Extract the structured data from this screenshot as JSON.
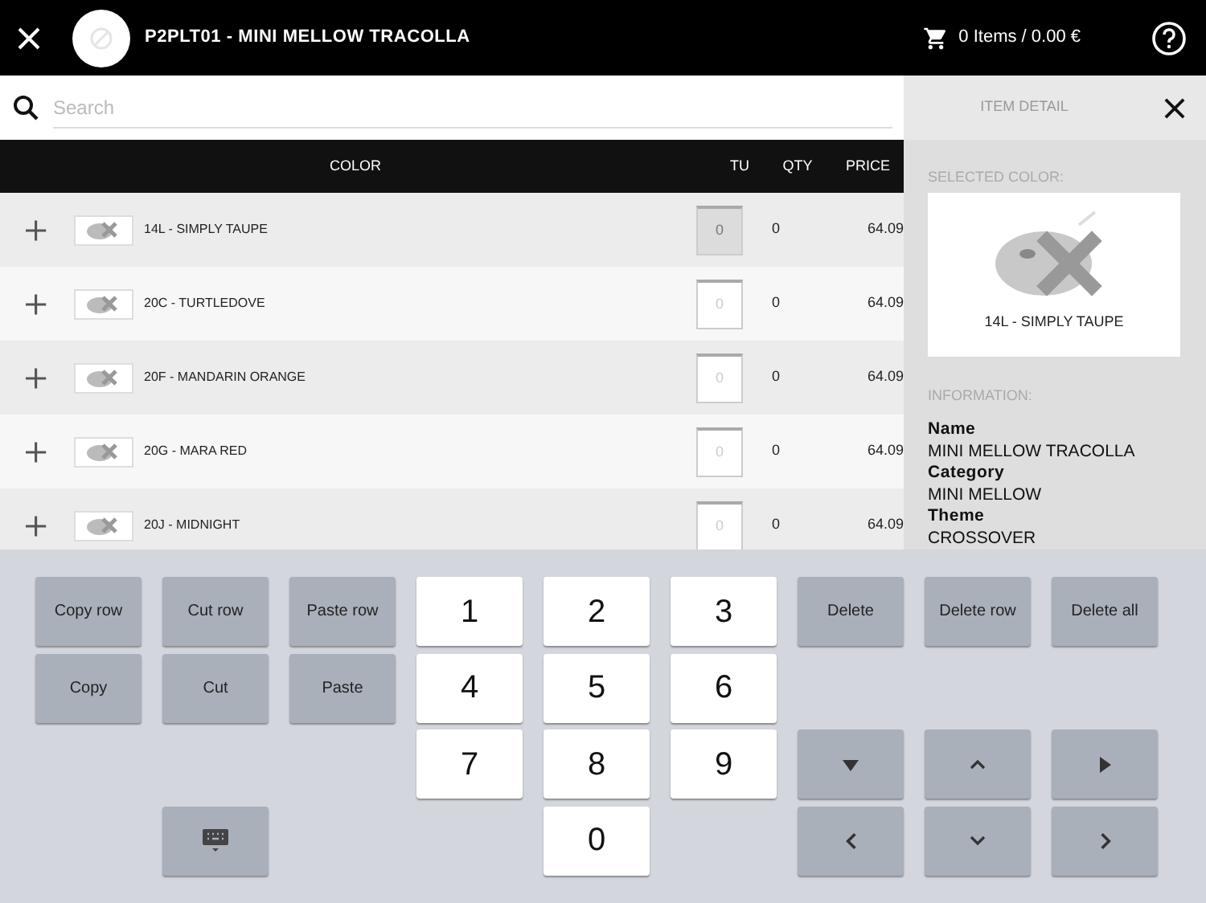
{
  "header": {
    "title": "P2PLT01 - MINI MELLOW TRACOLLA",
    "cart": "0 Items / 0.00 €"
  },
  "search": {
    "placeholder": "Search"
  },
  "table": {
    "columns": [
      "COLOR",
      "TU",
      "QTY",
      "PRICE"
    ],
    "rows": [
      {
        "name": "14L - SIMPLY TAUPE",
        "tu": "0",
        "qty": "0",
        "price": "64.09",
        "selected": true
      },
      {
        "name": "20C - TURTLEDOVE",
        "tu": "0",
        "qty": "0",
        "price": "64.09",
        "selected": false
      },
      {
        "name": "20F - MANDARIN ORANGE",
        "tu": "0",
        "qty": "0",
        "price": "64.09",
        "selected": false
      },
      {
        "name": "20G - MARA RED",
        "tu": "0",
        "qty": "0",
        "price": "64.09",
        "selected": false
      },
      {
        "name": "20J - MIDNIGHT",
        "tu": "0",
        "qty": "0",
        "price": "64.09",
        "selected": false
      }
    ]
  },
  "detail": {
    "title": "ITEM DETAIL",
    "selected_label": "SELECTED COLOR:",
    "selected_color": "14L - SIMPLY TAUPE",
    "info_label": "INFORMATION:",
    "fields": [
      {
        "label": "Name",
        "value": "MINI MELLOW TRACOLLA"
      },
      {
        "label": "Category",
        "value": "MINI MELLOW"
      },
      {
        "label": "Theme",
        "value": "CROSSOVER"
      }
    ]
  },
  "edit_buttons": [
    "Copy row",
    "Cut row",
    "Paste row",
    "Copy",
    "Cut",
    "Paste"
  ],
  "keyboard_button": {
    "kind": "keyboard"
  },
  "number_keys": [
    "1",
    "2",
    "3",
    "4",
    "5",
    "6",
    "7",
    "8",
    "9",
    "0"
  ],
  "delete_buttons": [
    "Delete",
    "Delete row",
    "Delete all"
  ],
  "arrow_keys": [
    {
      "kind": "triangle-down"
    },
    {
      "kind": "chevron-up"
    },
    {
      "kind": "triangle-right"
    },
    {
      "kind": "chevron-left"
    },
    {
      "kind": "chevron-down"
    },
    {
      "kind": "chevron-right"
    }
  ]
}
